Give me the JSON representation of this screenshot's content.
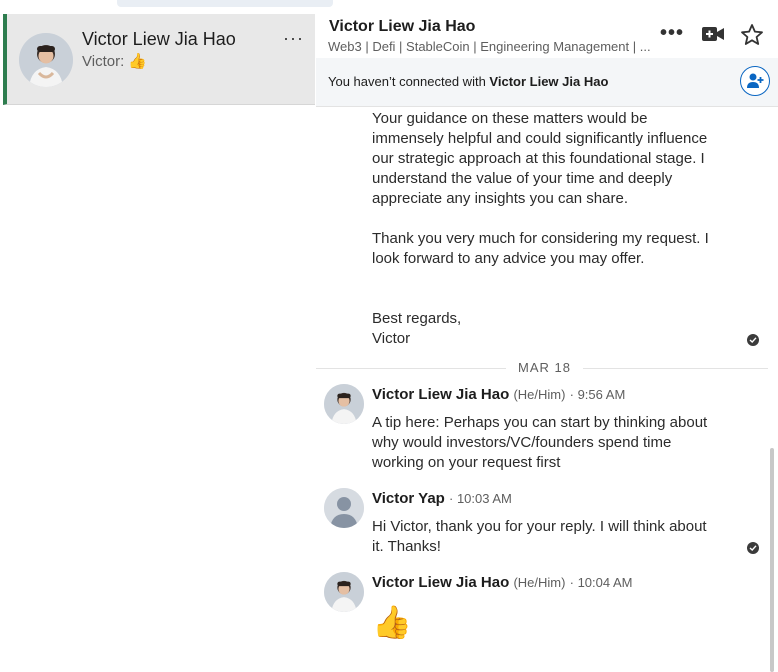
{
  "conversation": {
    "name": "Victor Liew Jia Hao",
    "preview": "Victor: 👍",
    "more": "···"
  },
  "header": {
    "title": "Victor Liew Jia Hao",
    "subtitle": "Web3 | Defi | StableCoin | Engineering Management | ..."
  },
  "notice": {
    "prefix": "You haven’t connected with ",
    "name": "Victor Liew Jia Hao"
  },
  "messages": {
    "para1": "Your guidance on these matters would be immensely helpful and could significantly influence our strategic approach at this foundational stage. I understand the value of your time and deeply appreciate any insights you can share.",
    "para2": "Thank you very much for considering my request. I look forward to any advice you may offer.",
    "para3a": "Best regards,",
    "para3b": "Victor",
    "date": "MAR 18",
    "m1": {
      "sender": "Victor Liew Jia Hao",
      "pronoun": "(He/Him)",
      "time": "9:56 AM",
      "text": "A tip here: Perhaps you can start by thinking about why would investors/VC/founders spend time working on your request first"
    },
    "m2": {
      "sender": "Victor Yap",
      "time": "10:03 AM",
      "text": "Hi Victor, thank you for your reply. I will think about it. Thanks!"
    },
    "m3": {
      "sender": "Victor Liew Jia Hao",
      "pronoun": "(He/Him)",
      "time": "10:04 AM",
      "text": "👍"
    }
  },
  "icons": {
    "more": "more-horizontal-icon",
    "video": "video-call-icon",
    "star": "star-icon",
    "add_connection": "add-person-icon",
    "read_receipt": "check-circle-icon"
  },
  "colors": {
    "accent": "#0a66c2",
    "active_bar": "#2e7d4f"
  }
}
